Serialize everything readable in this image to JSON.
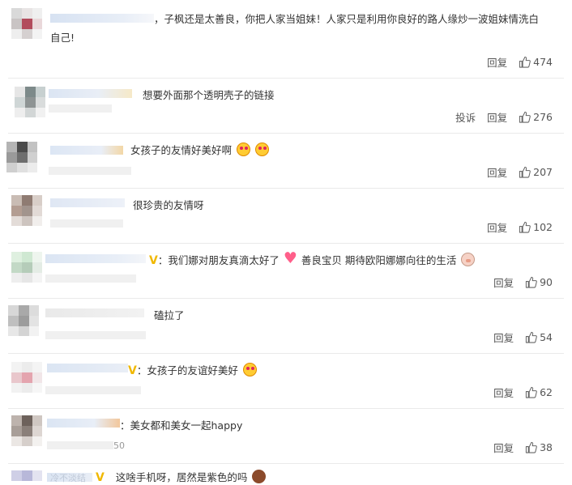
{
  "comments": [
    {
      "id": 1,
      "text_prefix": "，",
      "text_line1": "子枫还是太善良，你把人家当姐妹！人家只是利用你良好的路人缘炒一波姐妹情洗白",
      "text_line2": "自己!",
      "reply": "回复",
      "likes": "474"
    },
    {
      "id": 2,
      "text": "想要外面那个透明壳子的链接",
      "report": "投诉",
      "reply": "回复",
      "likes": "276"
    },
    {
      "id": 3,
      "text": "女孩子的友情好美好啊",
      "emojis": [
        "face-icon",
        "face-icon"
      ],
      "reply": "回复",
      "likes": "207"
    },
    {
      "id": 4,
      "text": "很珍贵的友情呀",
      "reply": "回复",
      "likes": "102"
    },
    {
      "id": 5,
      "badge": "V",
      "text_a": "：我们娜对朋友真滴太好了",
      "text_b": "善良宝贝 期待欧阳娜娜向往的生活",
      "reply": "回复",
      "likes": "90"
    },
    {
      "id": 6,
      "text": "磕拉了",
      "reply": "回复",
      "likes": "54"
    },
    {
      "id": 7,
      "badge": "V",
      "text": "：女孩子的友谊好美好",
      "reply": "回复",
      "likes": "62"
    },
    {
      "id": 8,
      "text": "：美女都和美女一起happy",
      "reply": "回复",
      "likes": "38",
      "sub_fragment": "50"
    },
    {
      "id": 9,
      "badge": "V",
      "text": "这啥手机呀，居然是紫色的吗",
      "name_fragment": "冷不淡结"
    }
  ],
  "colors": {
    "text": "#333333",
    "muted": "#555555",
    "divider": "#eaeaea",
    "badge": "#f0b800"
  }
}
